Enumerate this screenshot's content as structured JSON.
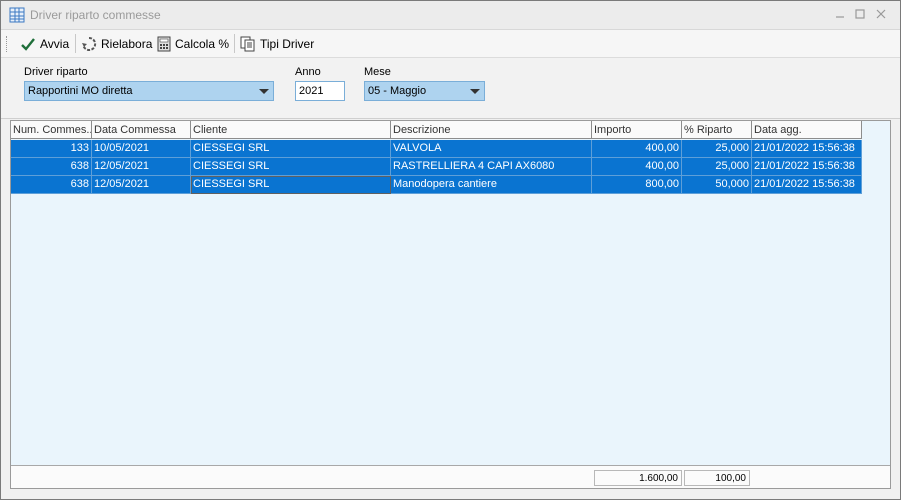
{
  "window": {
    "title": "Driver riparto commesse"
  },
  "toolbar": {
    "avvia_label": "Avvia",
    "rielabora_label": "Rielabora",
    "calcola_label": "Calcola %",
    "tipi_driver_label": "Tipi Driver"
  },
  "filters": {
    "driver_label": "Driver riparto",
    "driver_value": "Rapportini MO diretta",
    "anno_label": "Anno",
    "anno_value": "2021",
    "mese_label": "Mese",
    "mese_value": "05 - Maggio"
  },
  "grid": {
    "columns": [
      "Num. Commes...",
      "Data Commessa",
      "Cliente",
      "Descrizione",
      "Importo",
      "% Riparto",
      "Data agg."
    ],
    "rows": [
      [
        "133",
        "10/05/2021",
        "CIESSEGI SRL",
        "VALVOLA",
        "400,00",
        "25,000",
        "21/01/2022 15:56:38"
      ],
      [
        "638",
        "12/05/2021",
        "CIESSEGI SRL",
        "RASTRELLIERA 4 CAPI AX6080",
        "400,00",
        "25,000",
        "21/01/2022 15:56:38"
      ],
      [
        "638",
        "12/05/2021",
        "CIESSEGI SRL",
        "Manodopera cantiere",
        "800,00",
        "50,000",
        "21/01/2022 15:56:38"
      ]
    ],
    "totals": {
      "importo": "1.600,00",
      "riparto": "100,00"
    }
  },
  "colors": {
    "selection": "#0a74d1",
    "grid_background": "#eaf5fc",
    "combo_background": "#aed3ef"
  }
}
